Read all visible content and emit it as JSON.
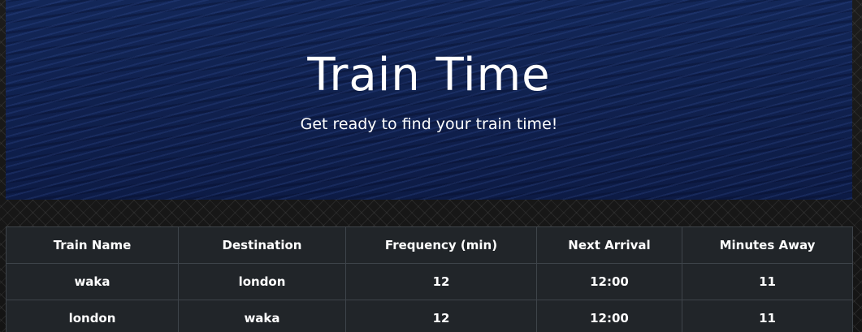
{
  "header": {
    "title": "Train Time",
    "subtitle": "Get ready to find your train time!"
  },
  "table": {
    "columns": [
      "Train Name",
      "Destination",
      "Frequency (min)",
      "Next Arrival",
      "Minutes Away"
    ],
    "rows": [
      [
        "waka",
        "london",
        "12",
        "12:00",
        "11"
      ],
      [
        "london",
        "waka",
        "12",
        "12:00",
        "11"
      ]
    ]
  },
  "colors": {
    "page_background": "#1a1a1a",
    "header_background": "#0f1e4a",
    "table_background": "#212529",
    "table_border": "#3e444a",
    "text": "#ffffff"
  }
}
